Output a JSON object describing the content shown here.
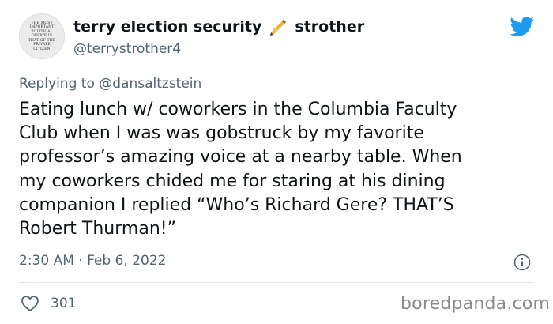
{
  "author": {
    "display_name_first": "terry election security",
    "display_name_last": "strother",
    "handle": "@terrystrother4",
    "avatar_text": [
      "THE MOST",
      "IMPORTANT",
      "POLITICAL",
      "OFFICE IS",
      "THAT OF THE",
      "PRIVATE",
      "CITIZEN"
    ]
  },
  "reply": {
    "prefix": "Replying to",
    "mention": "@dansaltzstein"
  },
  "tweet": {
    "lines": [
      "Eating lunch w/ coworkers in the Columbia Faculty",
      "Club when I was was gobstruck by my favorite",
      "professor’s amazing voice at a nearby table. When",
      "my coworkers chided me for staring at his dining",
      "companion I replied “Who’s Richard Gere? THAT’S",
      "Robert Thurman!”"
    ],
    "timestamp": "2:30 AM · Feb 6, 2022",
    "likes": "301"
  },
  "watermark": "boredpanda.com",
  "icons": {
    "pen": "writing-hand-icon",
    "bird": "twitter-bird-icon",
    "info": "info-icon",
    "like": "heart-icon"
  },
  "colors": {
    "text": "#0f1419",
    "secondary": "#536471",
    "twitter_blue": "#1d9bf0",
    "divider": "#e4e8eb"
  }
}
